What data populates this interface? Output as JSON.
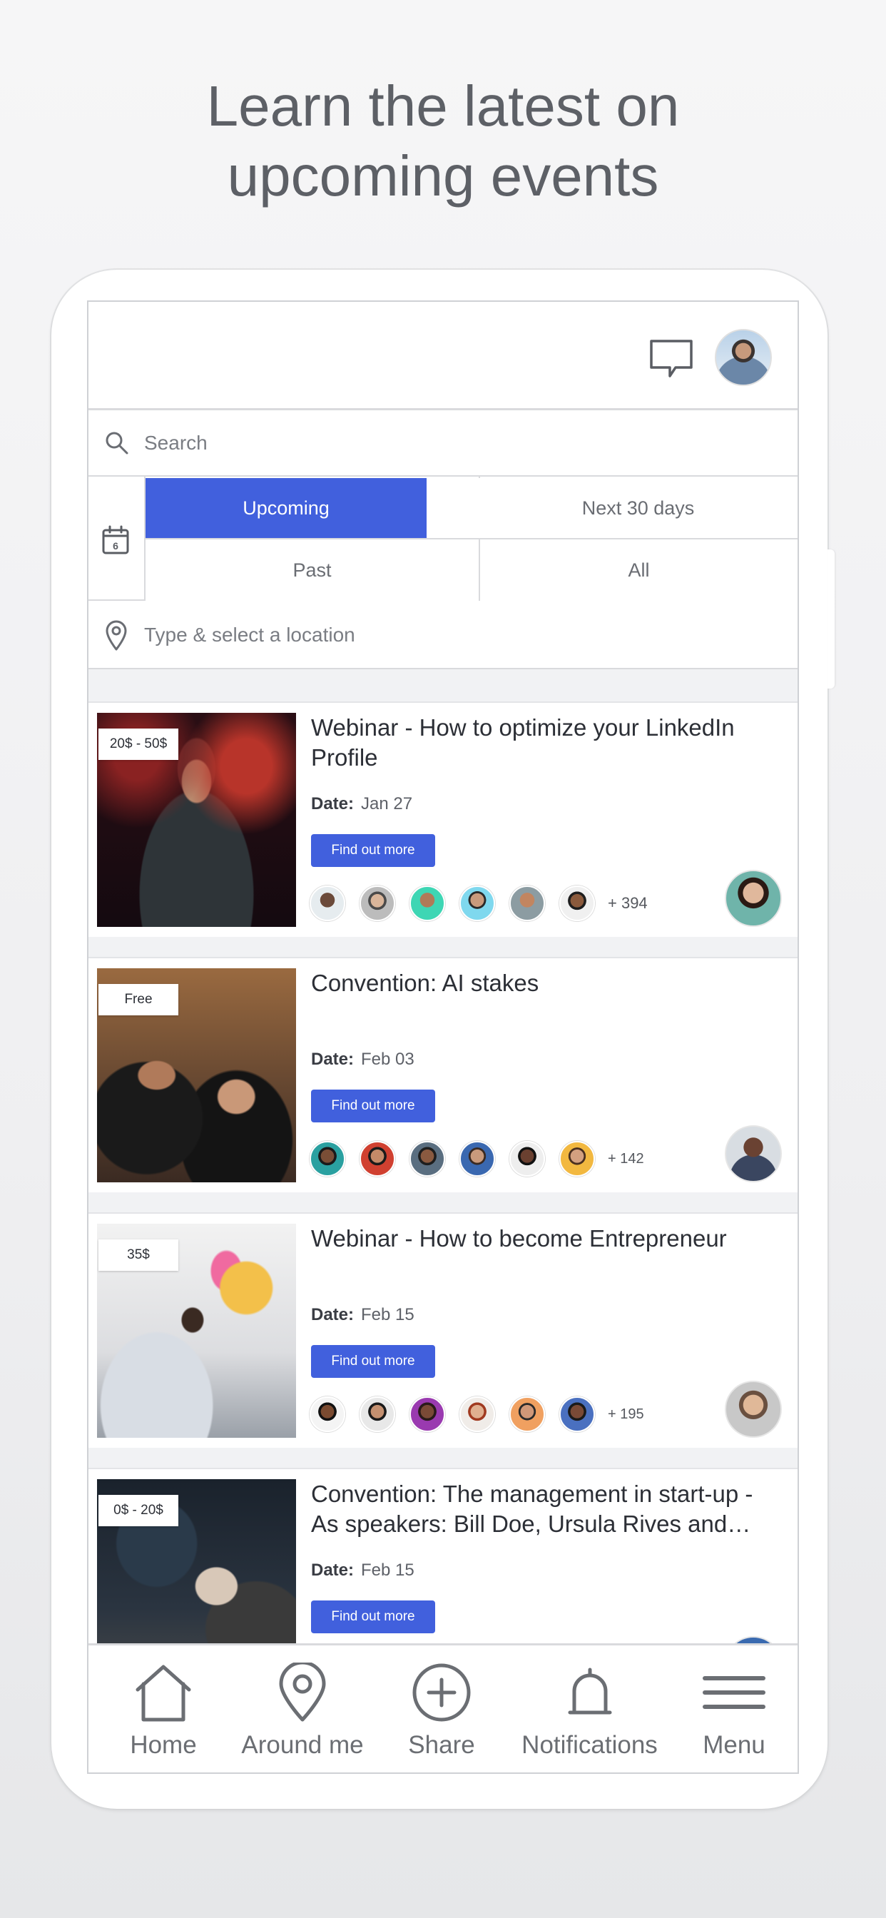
{
  "headline": {
    "line1": "Learn the latest on",
    "line2": "upcoming events"
  },
  "topbar": {
    "chat_icon": "chat-bubble-icon",
    "avatar": "user-avatar"
  },
  "search": {
    "placeholder": "Search",
    "icon": "search-icon"
  },
  "filters": {
    "calendar_icon_text": "6",
    "upcoming": "Upcoming",
    "next_30_days": "Next 30 days",
    "past": "Past",
    "all": "All",
    "active": "Upcoming",
    "accent_color": "#4160dd"
  },
  "location": {
    "placeholder": "Type & select a location",
    "icon": "location-pin-icon"
  },
  "events": [
    {
      "price": "20$ - 50$",
      "title": "Webinar - How to optimize your LinkedIn Profile",
      "date_label": "Date:",
      "date": "Jan 27",
      "button": "Find out more",
      "more_count": "+ 394"
    },
    {
      "price": "Free",
      "title": "Convention: AI stakes",
      "date_label": "Date:",
      "date": "Feb 03",
      "button": "Find out more",
      "more_count": "+ 142"
    },
    {
      "price": "35$",
      "title": "Webinar - How to become Entrepreneur",
      "date_label": "Date:",
      "date": "Feb 15",
      "button": "Find out more",
      "more_count": "+ 195"
    },
    {
      "price": "0$ - 20$",
      "title": "Convention: The management in start-up - As speakers: Bill Doe, Ursula Rives and…",
      "date_label": "Date:",
      "date": "Feb 15",
      "button": "Find out more"
    }
  ],
  "tabbar": {
    "home": "Home",
    "around_me": "Around me",
    "share": "Share",
    "notifications": "Notifications",
    "menu": "Menu"
  }
}
